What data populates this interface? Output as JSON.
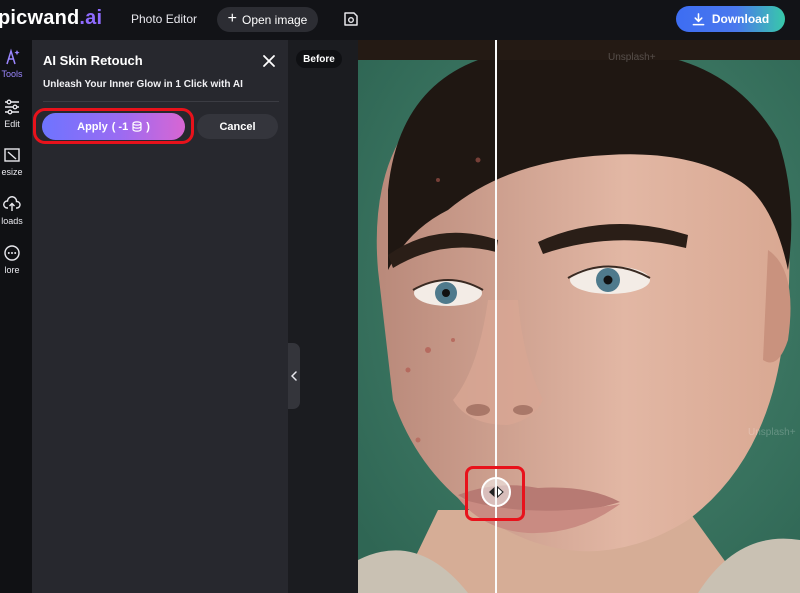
{
  "header": {
    "logo_main": "picwand",
    "logo_accent": ".ai",
    "photo_editor_label": "Photo Editor",
    "open_image_label": "Open image",
    "download_label": "Download",
    "save_icon": "save-icon"
  },
  "leftnav": {
    "items": [
      {
        "label": "Tools",
        "icon": "ai-sparkle-icon",
        "active": true
      },
      {
        "label": "Edit",
        "icon": "sliders-icon"
      },
      {
        "label": "Resize",
        "icon": "resize-icon"
      },
      {
        "label": "Uploads",
        "icon": "upload-icon"
      },
      {
        "label": "More",
        "icon": "more-icon"
      }
    ],
    "visible_labels": [
      "Tools",
      "Edit",
      "esize",
      "loads",
      "lore"
    ]
  },
  "panel": {
    "title": "AI Skin Retouch",
    "subtitle": "Unleash Your Inner Glow in 1 Click with AI",
    "apply_label": "Apply",
    "apply_cost": "( -1",
    "apply_close": ")",
    "cancel_label": "Cancel"
  },
  "canvas": {
    "before_label": "Before",
    "watermark": "Unsplash+"
  },
  "colors": {
    "accent_purple": "#8f6bff",
    "highlight_red": "#e8121b",
    "download_start": "#3d6df2",
    "download_end": "#38c9a9",
    "photo_background": "#3f7c68"
  }
}
